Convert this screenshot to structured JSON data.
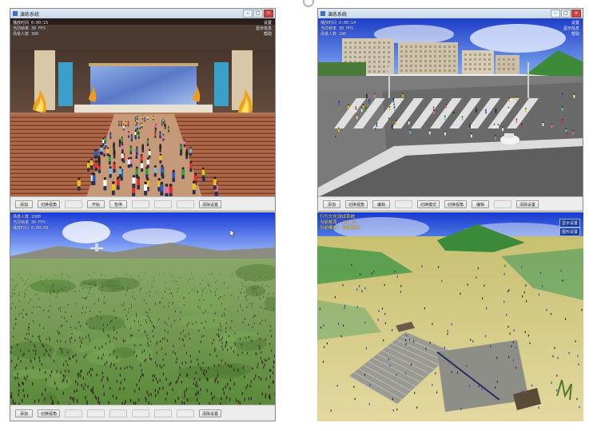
{
  "top_indicator_icon": "circle-outline-icon",
  "panels": [
    {
      "name": "auditorium",
      "window_title": "演练系统",
      "hud_lines": [
        "播放时间 0:00:15",
        "当前帧率 30 FPS",
        "场景人数 300"
      ],
      "hud_right": [
        "设置",
        "显示信息",
        "帮助"
      ],
      "toolbar": [
        {
          "label": "添加",
          "enabled": true
        },
        {
          "label": "切换视角",
          "enabled": true
        },
        {
          "label": "",
          "enabled": false
        },
        {
          "label": "开始",
          "enabled": true
        },
        {
          "label": "暂停",
          "enabled": true
        },
        {
          "label": "",
          "enabled": false
        },
        {
          "label": "",
          "enabled": false
        },
        {
          "label": "",
          "enabled": false
        },
        {
          "label": "清除设置",
          "enabled": true
        }
      ]
    },
    {
      "name": "street",
      "window_title": "演练系统",
      "hud_lines": [
        "播放时间 0:00:14",
        "当前帧率 30 FPS",
        "场景人数 200"
      ],
      "hud_right": [
        "设置",
        "显示信息",
        "帮助"
      ],
      "toolbar": [
        {
          "label": "添加",
          "enabled": true
        },
        {
          "label": "切换视角",
          "enabled": true
        },
        {
          "label": "编辑",
          "enabled": true
        },
        {
          "label": "",
          "enabled": false
        },
        {
          "label": "切换模式",
          "enabled": true
        },
        {
          "label": "切换视角",
          "enabled": true
        },
        {
          "label": "编辑",
          "enabled": true
        },
        {
          "label": "",
          "enabled": false
        },
        {
          "label": "清除设置",
          "enabled": true
        }
      ]
    },
    {
      "name": "terrain",
      "hud_lines": [
        "场景人数 1000",
        "当前帧率 30 FPS",
        "播放时间 0:00:09"
      ],
      "toolbar": [
        {
          "label": "添加",
          "enabled": true
        },
        {
          "label": "切换视角",
          "enabled": true
        },
        {
          "label": "",
          "enabled": false
        },
        {
          "label": "",
          "enabled": false
        },
        {
          "label": "",
          "enabled": false
        },
        {
          "label": "",
          "enabled": false
        },
        {
          "label": "",
          "enabled": false
        },
        {
          "label": "",
          "enabled": false
        },
        {
          "label": "清除设置",
          "enabled": true
        }
      ]
    },
    {
      "name": "hillside",
      "hud_lines": [
        "行为文化测试系统",
        "当前帧率: 28.39",
        "当前模式: 编辑模式"
      ],
      "hud_right": [
        "显示设置",
        "图形设置"
      ]
    }
  ]
}
